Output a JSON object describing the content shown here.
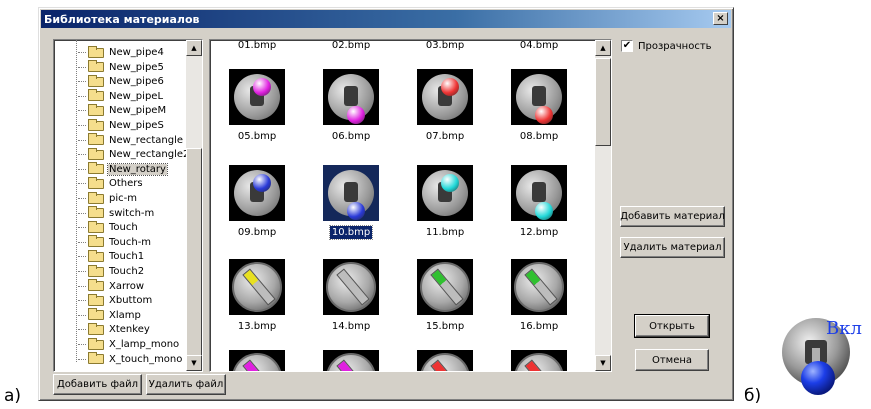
{
  "window": {
    "title": "Библиотека материалов",
    "close_glyph": "×"
  },
  "tree": {
    "items": [
      {
        "label": "New_pipe4"
      },
      {
        "label": "New_pipe5"
      },
      {
        "label": "New_pipe6"
      },
      {
        "label": "New_pipeL"
      },
      {
        "label": "New_pipeM"
      },
      {
        "label": "New_pipeS"
      },
      {
        "label": "New_rectangle"
      },
      {
        "label": "New_rectangle2"
      },
      {
        "label": "New_rotary",
        "selected": true
      },
      {
        "label": "Others"
      },
      {
        "label": "pic-m"
      },
      {
        "label": "switch-m"
      },
      {
        "label": "Touch"
      },
      {
        "label": "Touch-m"
      },
      {
        "label": "Touch1"
      },
      {
        "label": "Touch2"
      },
      {
        "label": "Xarrow"
      },
      {
        "label": "Xbuttom"
      },
      {
        "label": "Xlamp"
      },
      {
        "label": "Xtenkey"
      },
      {
        "label": "X_lamp_mono"
      },
      {
        "label": "X_touch_mono"
      }
    ]
  },
  "gallery": {
    "top_partial": [
      "01.bmp",
      "02.bmp",
      "03.bmp",
      "04.bmp"
    ],
    "rows": [
      [
        {
          "name": "05.bmp",
          "kind": "toggle",
          "color": "#e020e0",
          "pos": "up"
        },
        {
          "name": "06.bmp",
          "kind": "toggle",
          "color": "#e020e0",
          "pos": "down"
        },
        {
          "name": "07.bmp",
          "kind": "toggle",
          "color": "#ee3333",
          "pos": "up"
        },
        {
          "name": "08.bmp",
          "kind": "toggle",
          "color": "#ee3333",
          "pos": "down"
        }
      ],
      [
        {
          "name": "09.bmp",
          "kind": "toggle",
          "color": "#2a3ad8",
          "pos": "up"
        },
        {
          "name": "10.bmp",
          "kind": "toggle",
          "color": "#2a3ad8",
          "pos": "down",
          "selected": true
        },
        {
          "name": "11.bmp",
          "kind": "toggle",
          "color": "#20d8d8",
          "pos": "up"
        },
        {
          "name": "12.bmp",
          "kind": "toggle",
          "color": "#20d8d8",
          "pos": "down"
        }
      ],
      [
        {
          "name": "13.bmp",
          "kind": "rotary",
          "color": "#e8e020",
          "tip": true
        },
        {
          "name": "14.bmp",
          "kind": "rotary",
          "color": "#bdbdbd",
          "tip": false
        },
        {
          "name": "15.bmp",
          "kind": "rotary",
          "color": "#30c030",
          "tip": true
        },
        {
          "name": "16.bmp",
          "kind": "rotary",
          "color": "#30c030",
          "tip": true
        }
      ]
    ],
    "bottom_partial": [
      {
        "color": "#e020e0"
      },
      {
        "color": "#e020e0"
      },
      {
        "color": "#ee3333"
      },
      {
        "color": "#ee3333"
      }
    ]
  },
  "controls": {
    "transparency_label": "Прозрачность",
    "transparency_checked": true,
    "check_glyph": "✔",
    "add_material": "Добавить материал",
    "delete_material": "Удалить материал",
    "open": "Открыть",
    "cancel": "Отмена",
    "add_file": "Добавить файл",
    "delete_file": "Удалить файл"
  },
  "labels": {
    "a": "а)",
    "b": "б)",
    "preview_text": "Вкл"
  },
  "colors": {
    "title_start": "#0a246a",
    "selection": "#0a246a",
    "preview_ball": "#1c3ee8"
  },
  "icons": {
    "scroll_up": "▲",
    "scroll_down": "▼"
  }
}
